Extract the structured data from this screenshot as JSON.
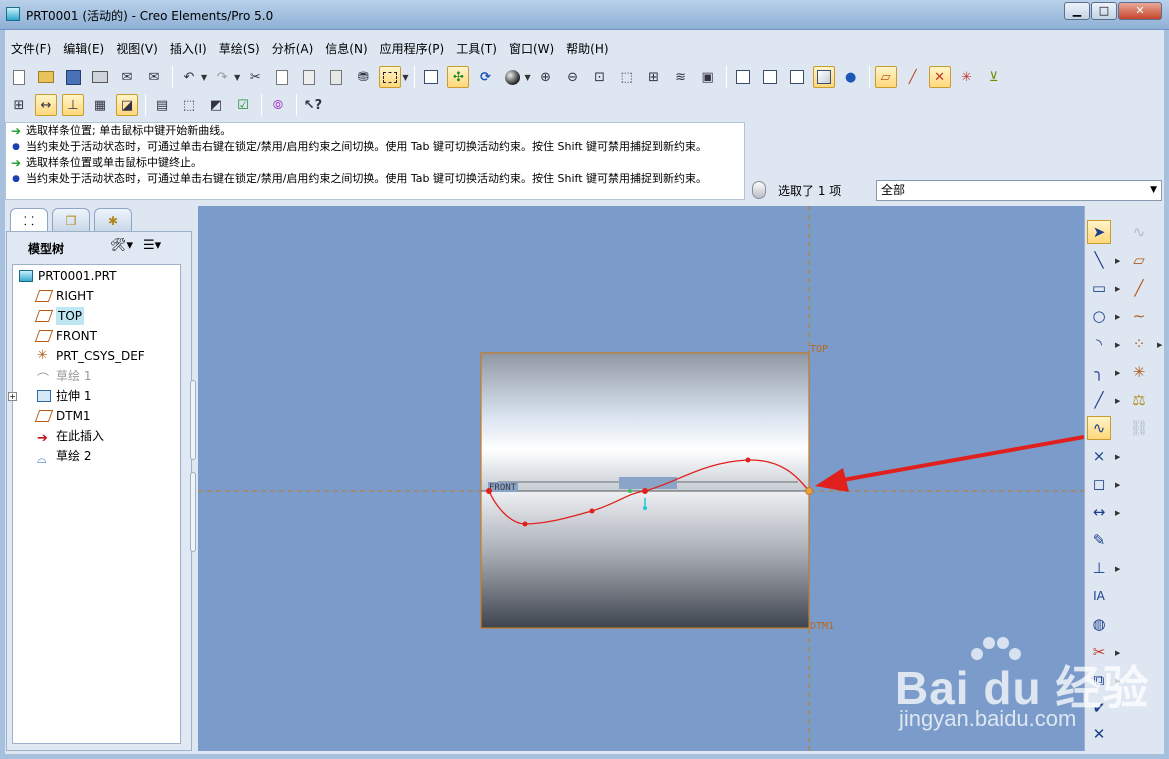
{
  "window": {
    "title": "PRT0001 (活动的) - Creo Elements/Pro 5.0",
    "buttons": {
      "minimize": "▁",
      "maximize": "□",
      "close": "✕"
    }
  },
  "menu": [
    "文件(F)",
    "编辑(E)",
    "视图(V)",
    "插入(I)",
    "草绘(S)",
    "分析(A)",
    "信息(N)",
    "应用程序(P)",
    "工具(T)",
    "窗口(W)",
    "帮助(H)"
  ],
  "messages": [
    {
      "type": "prompt",
      "text": "选取样条位置; 单击鼠标中键开始新曲线。"
    },
    {
      "type": "info",
      "text": "当约束处于活动状态时，可通过单击右键在锁定/禁用/启用约束之间切换。使用 Tab 键可切换活动约束。按住 Shift 键可禁用捕捉到新约束。"
    },
    {
      "type": "prompt",
      "text": "选取样条位置或单击鼠标中键终止。"
    },
    {
      "type": "info",
      "text": "当约束处于活动状态时，可通过单击右键在锁定/禁用/启用约束之间切换。使用 Tab 键可切换活动约束。按住 Shift 键可禁用捕捉到新约束。"
    }
  ],
  "selection": {
    "status": "选取了 1 项",
    "filter": "全部"
  },
  "navigator": {
    "title": "模型树",
    "tree": [
      {
        "label": "PRT0001.PRT",
        "icon": "part-icon",
        "level": 0
      },
      {
        "label": "RIGHT",
        "icon": "datum-plane-icon",
        "level": 1
      },
      {
        "label": "TOP",
        "icon": "datum-plane-icon",
        "level": 1,
        "highlighted": true
      },
      {
        "label": "FRONT",
        "icon": "datum-plane-icon",
        "level": 1
      },
      {
        "label": "PRT_CSYS_DEF",
        "icon": "csys-icon",
        "level": 1
      },
      {
        "label": "草绘 1",
        "icon": "sketch-icon",
        "level": 1,
        "dimmed": true
      },
      {
        "label": "拉伸 1",
        "icon": "extrude-icon",
        "level": 1,
        "expandable": true
      },
      {
        "label": "DTM1",
        "icon": "datum-plane-icon",
        "level": 1
      },
      {
        "label": "在此插入",
        "icon": "insert-here-icon",
        "level": 1
      },
      {
        "label": "草绘 2",
        "icon": "sketch-icon",
        "level": 1
      }
    ]
  },
  "graphics": {
    "datum_labels": {
      "top": "TOP",
      "dtm": "DTM1",
      "front": "FRONT"
    },
    "colors": {
      "background": "#7b9ccb",
      "spline": "#e0201c",
      "datum": "#c87a1e",
      "arrow": "#e0201c"
    }
  },
  "watermark": {
    "logo": "Bai du 经验",
    "url": "jingyan.baidu.com"
  }
}
